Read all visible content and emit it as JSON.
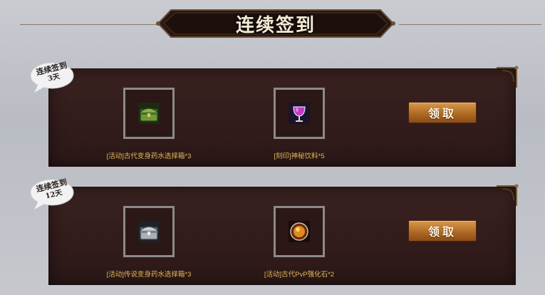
{
  "header": {
    "title": "连续签到"
  },
  "rows": [
    {
      "badge": {
        "line1": "连续签到",
        "line2": "3天"
      },
      "items": [
        {
          "icon": "green-chest-icon",
          "label": "[活动]古代变身药水选择箱*3"
        },
        {
          "icon": "purple-potion-glass-icon",
          "label": "[刻印]神秘饮料*5"
        }
      ],
      "claim_label": "领取"
    },
    {
      "badge": {
        "line1": "连续签到",
        "line2": "12天"
      },
      "items": [
        {
          "icon": "silver-chest-icon",
          "label": "[活动]传说变身药水选择箱*3"
        },
        {
          "icon": "amber-orb-icon",
          "label": "[活动]古代PvP强化石*2"
        }
      ],
      "claim_label": "领取"
    }
  ],
  "colors": {
    "panel": "#2b1817",
    "label_gold": "#e3b75a",
    "button": "#b06a24",
    "slot_border": "#8c8a88"
  }
}
